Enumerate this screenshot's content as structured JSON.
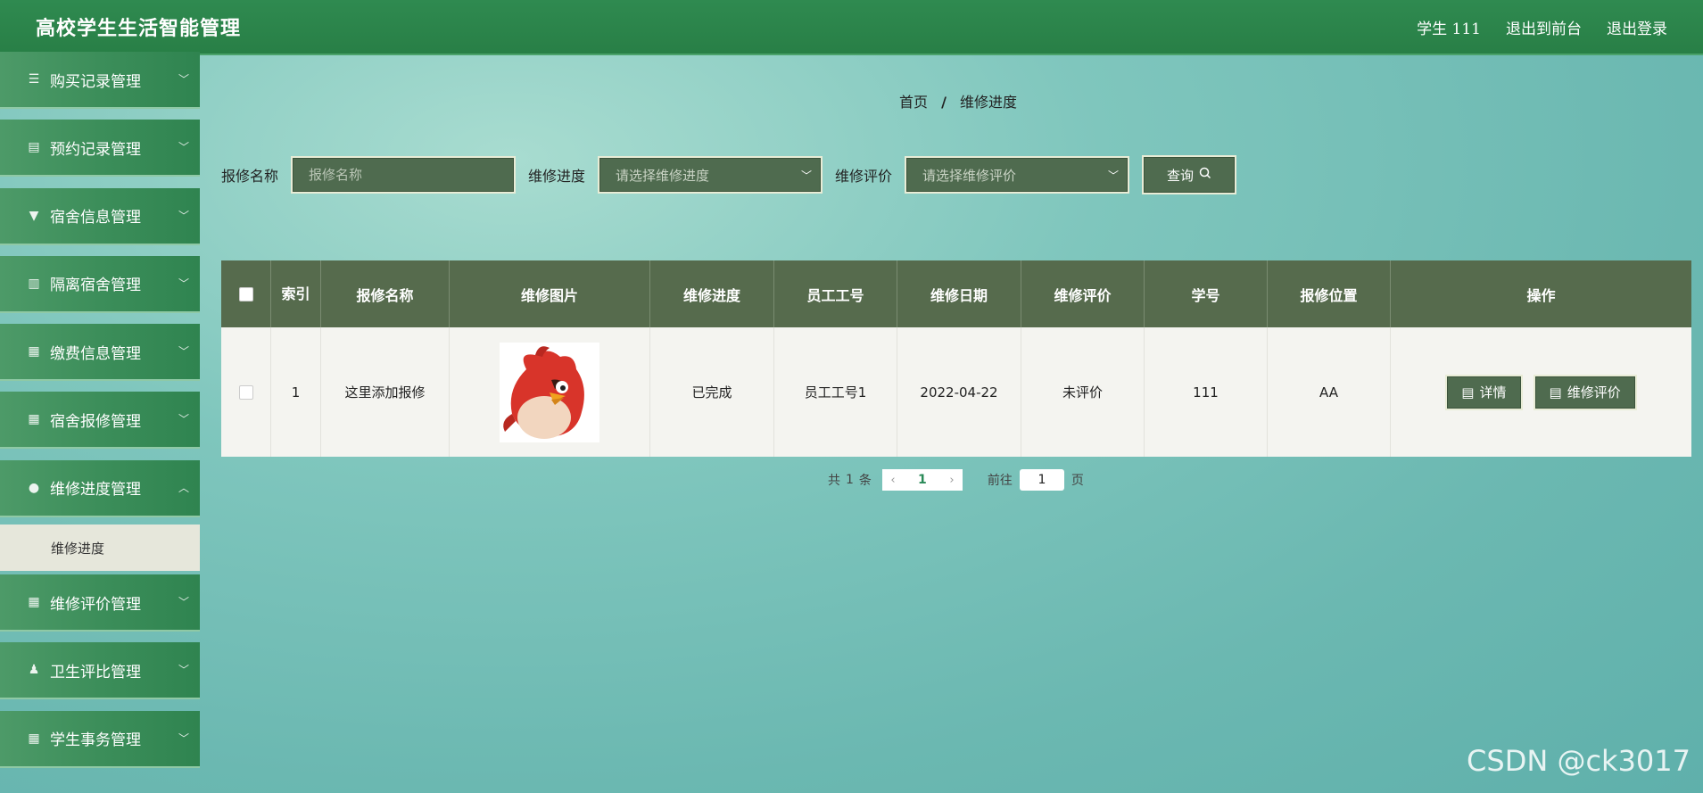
{
  "header": {
    "title": "高校学生生活智能管理",
    "user_label": "学生 111",
    "to_front_label": "退出到前台",
    "logout_label": "退出登录"
  },
  "sidebar": {
    "items": [
      {
        "label": "购买记录管理",
        "icon": "list-icon"
      },
      {
        "label": "预约记录管理",
        "icon": "document-icon"
      },
      {
        "label": "宿舍信息管理",
        "icon": "cup-icon"
      },
      {
        "label": "隔离宿舍管理",
        "icon": "book-icon"
      },
      {
        "label": "缴费信息管理",
        "icon": "grid-icon"
      },
      {
        "label": "宿舍报修管理",
        "icon": "grid-icon"
      },
      {
        "label": "维修进度管理",
        "icon": "location-icon"
      },
      {
        "label": "维修评价管理",
        "icon": "grid-icon"
      },
      {
        "label": "卫生评比管理",
        "icon": "user-icon"
      },
      {
        "label": "学生事务管理",
        "icon": "grid-icon"
      }
    ],
    "active_sub": "维修进度"
  },
  "breadcrumb": {
    "home": "首页",
    "sep": "/",
    "current": "维修进度"
  },
  "search": {
    "name_label": "报修名称",
    "name_placeholder": "报修名称",
    "progress_label": "维修进度",
    "progress_placeholder": "请选择维修进度",
    "eval_label": "维修评价",
    "eval_placeholder": "请选择维修评价",
    "query_label": "查询"
  },
  "table": {
    "headers": [
      "索引",
      "报修名称",
      "维修图片",
      "维修进度",
      "员工工号",
      "维修日期",
      "维修评价",
      "学号",
      "报修位置",
      "操作"
    ],
    "rows": [
      {
        "index": "1",
        "name": "这里添加报修",
        "progress": "已完成",
        "staff_no": "员工工号1",
        "date": "2022-04-22",
        "evaluation": "未评价",
        "student_no": "111",
        "location": "AA",
        "detail_label": "详情",
        "evaluate_label": "维修评价"
      }
    ]
  },
  "pagination": {
    "total_prefix": "共",
    "total": "1",
    "total_suffix": "条",
    "current_page": "1",
    "goto_label": "前往",
    "goto_value": "1",
    "page_suffix": "页"
  },
  "watermark": "CSDN @ck3017",
  "colors": {
    "header_green": "#2f8a50",
    "table_head": "#566b4d",
    "control_bg": "#4f6b4f"
  }
}
